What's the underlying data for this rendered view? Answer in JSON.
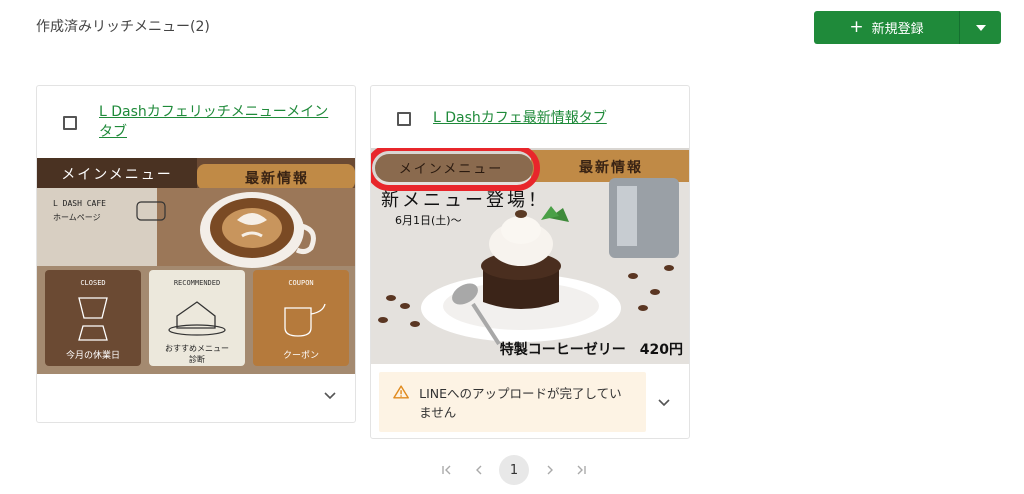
{
  "header": {
    "title": "作成済みリッチメニュー(2)",
    "new_button_label": "新規登録",
    "new_button_icon": "plus-icon",
    "dropdown_icon": "caret-down-icon",
    "accent_color": "#1f8a3a"
  },
  "cards": [
    {
      "title": "L Dashカフェリッチメニューメインタブ",
      "image": {
        "tab_main": "メインメニュー",
        "tab_news": "最新情報",
        "brand_line1": "L DASH CAFE",
        "brand_line2": "ホームページ",
        "tiles": [
          {
            "top": "CLOSED",
            "bottom": "今月の休業日"
          },
          {
            "top": "RECOMMENDED",
            "bottom": "おすすめメニュー\n診断"
          },
          {
            "top": "COUPON",
            "bottom": "クーポン"
          }
        ]
      }
    },
    {
      "title": "L Dashカフェ最新情報タブ",
      "image": {
        "tab_main": "メインメニュー",
        "tab_news": "最新情報",
        "headline": "新メニュー登場！",
        "date": "6月1日(土)〜",
        "product": "特製コーヒーゼリー　420円"
      },
      "warning": "LINEへのアップロードが完了していません",
      "warning_color": "#fdf3e4"
    }
  ],
  "pagination": {
    "first": "|<",
    "prev": "<",
    "current": "1",
    "next": ">",
    "last": ">|"
  }
}
